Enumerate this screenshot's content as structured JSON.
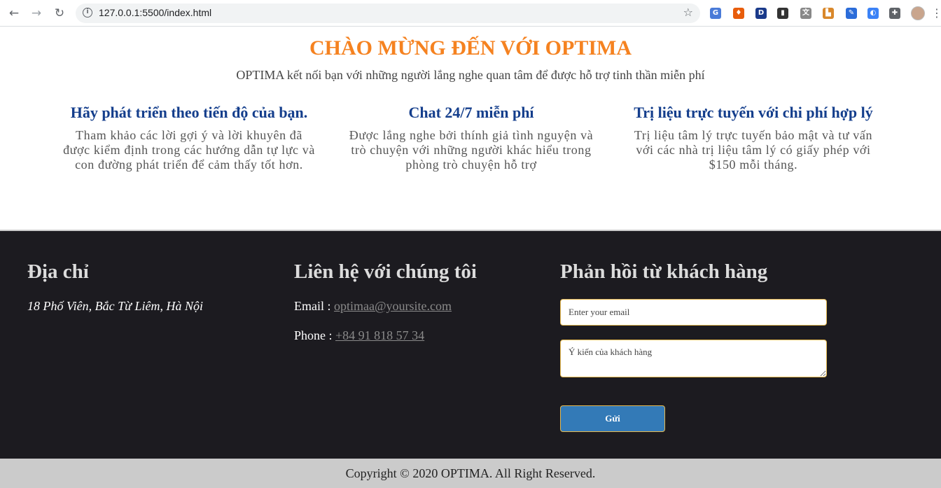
{
  "browser": {
    "back_icon": "←",
    "forward_icon": "→",
    "reload_icon": "↻",
    "url": "127.0.0.1:5500/index.html",
    "star_icon": "☆",
    "extensions": [
      {
        "name": "google-translate-ext-icon",
        "label": "G",
        "color": "#4a7bd8"
      },
      {
        "name": "honey-ext-icon",
        "label": "♦",
        "color": "#e85d0c"
      },
      {
        "name": "d-ext-icon",
        "label": "D",
        "color": "#1a3a8a"
      },
      {
        "name": "dark-ext-icon",
        "label": "▮",
        "color": "#333333"
      },
      {
        "name": "translate-ext-icon",
        "label": "文",
        "color": "#888888"
      },
      {
        "name": "ruler-ext-icon",
        "label": "▙",
        "color": "#d9882b"
      },
      {
        "name": "eyedropper-ext-icon",
        "label": "✎",
        "color": "#2b6cd9"
      },
      {
        "name": "compass-ext-icon",
        "label": "◐",
        "color": "#3b82f6"
      },
      {
        "name": "puzzle-ext-icon",
        "label": "✚",
        "color": "#5f6368"
      }
    ],
    "menu_icon": "⋮"
  },
  "hero": {
    "title": "CHÀO MỪNG ĐẾN VỚI OPTIMA",
    "subtitle": "OPTIMA kết nối bạn với những người lắng nghe quan tâm để được hỗ trợ tinh thần miễn phí"
  },
  "features": [
    {
      "title": "Hãy phát triển theo tiến độ của bạn.",
      "text": "Tham khảo các lời gợi ý và lời khuyên đã được kiểm định trong các hướng dẫn tự lực và con đường phát triển để cảm thấy tốt hơn."
    },
    {
      "title": "Chat 24/7 miễn phí",
      "text": "Được lắng nghe bởi thính giả tình nguyện và trò chuyện với những người khác hiểu trong phòng trò chuyện hỗ trợ"
    },
    {
      "title": "Trị liệu trực tuyến với chi phí hợp lý",
      "text": "Trị liệu tâm lý trực tuyến bảo mật và tư vấn với các nhà trị liệu tâm lý có giấy phép với $150 mỗi tháng."
    }
  ],
  "footer": {
    "address": {
      "heading": "Địa chỉ",
      "text": "18 Phố Viên, Bắc Từ Liêm, Hà Nội"
    },
    "contact": {
      "heading": "Liên hệ với chúng tôi",
      "email_label": "Email : ",
      "email": "optimaa@yoursite.com",
      "phone_label": "Phone : ",
      "phone": "+84 91 818 57 34"
    },
    "feedback": {
      "heading": "Phản hồi từ khách hàng",
      "email_placeholder": "Enter your email",
      "comment_placeholder": "Ý kiến của khách hàng",
      "send_label": "Gửi"
    }
  },
  "copyright": "Copyright © 2020 OPTIMA. All Right Reserved."
}
